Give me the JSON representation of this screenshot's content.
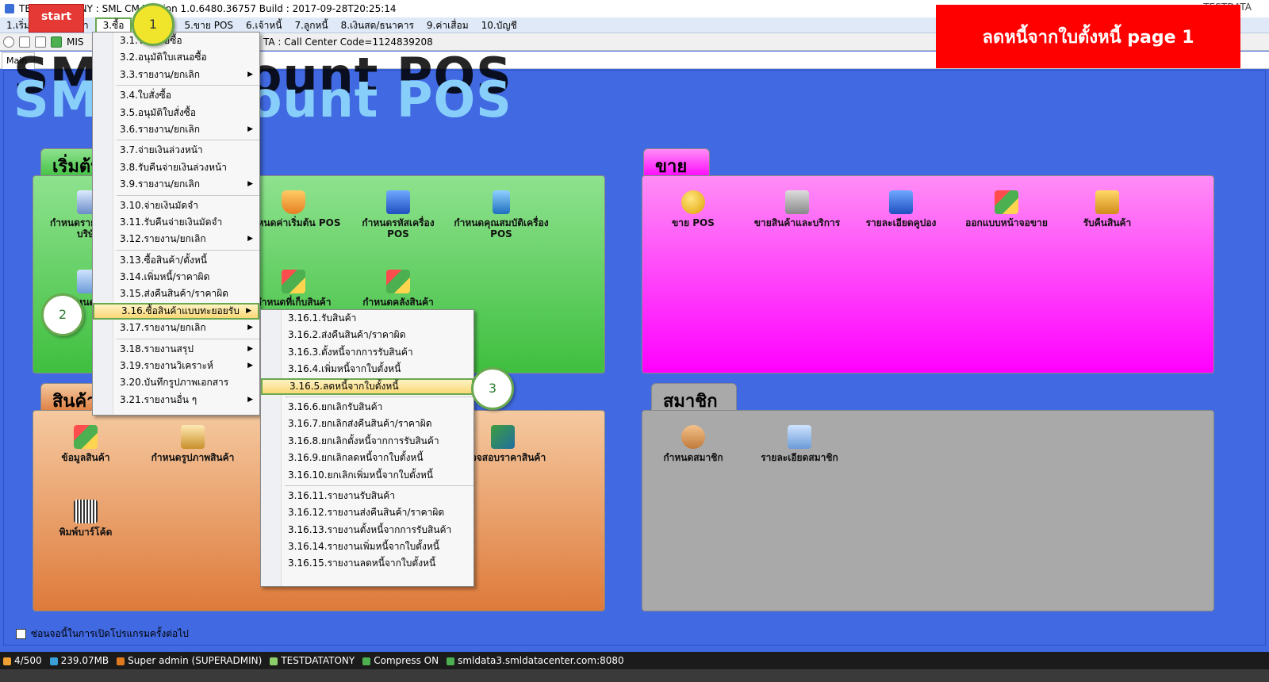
{
  "window": {
    "title": "TESTDATATONY : SML CM Version 1.0.6480.36757  Build : 2017-09-28T20:25:14",
    "top_right": "TESTDATA"
  },
  "start_label": "start",
  "banner": "ลดหนี้จากใบตั้งหนี้  page 1",
  "menubar": {
    "items": [
      "1.เริ่มต้น",
      "2.สินค้า",
      "3.ซื้อ",
      "5.ขาย POS",
      "6.เจ้าหนี้",
      "7.ลูกหนี้",
      "8.เงินสด/ธนาคาร",
      "9.ค่าเสื่อม",
      "10.บัญชี"
    ]
  },
  "toolbar": {
    "mis": "MIS",
    "call_center": "TA : Call Center Code=1124839208"
  },
  "tab_main": "Main",
  "big_title": "SML Account POS",
  "panels": {
    "start": {
      "label": "เริ่มต้น"
    },
    "product": {
      "label": "สินค้า"
    },
    "sale": {
      "label": "ขาย"
    },
    "member": {
      "label": "สมาชิก"
    }
  },
  "tiles": {
    "start": [
      "กำหนดรายละเอียดบริษัท",
      "กำหนดค่าเริ่มต้น POS",
      "กำหนดรหัสเครื่อง POS",
      "กำหนดคุณสมบัติเครื่อง POS",
      "กำหนดผู้ใช้",
      "กำหนดที่เก็บสินค้า",
      "กำหนดคลังสินค้า"
    ],
    "product": [
      "ข้อมูลสินค้า",
      "กำหนดรูปภาพสินค้า",
      "ตรวจสอบราคาสินค้า",
      "พิมพ์บาร์โค้ด"
    ],
    "sale": [
      "ขาย POS",
      "ขายสินค้าและบริการ",
      "รายละเอียดคูปอง",
      "ออกแบบหน้าจอขาย",
      "รับคืนสินค้า"
    ],
    "member": [
      "กำหนดสมาชิก",
      "รายละเอียดสมาชิก"
    ]
  },
  "checkbox_label": "ซ่อนจอนี้ในการเปิดโปรแกรมครั้งต่อไป",
  "menu_buy": {
    "items": [
      {
        "label": "3.1.ใบเสนอซื้อ",
        "sub": false
      },
      {
        "label": "3.2.อนุมัติใบเสนอซื้อ",
        "sub": false
      },
      {
        "label": "3.3.รายงาน/ยกเลิก",
        "sub": true
      },
      {
        "label": "3.4.ใบสั่งซื้อ",
        "sub": false
      },
      {
        "label": "3.5.อนุมัติใบสั่งซื้อ",
        "sub": false
      },
      {
        "label": "3.6.รายงาน/ยกเลิก",
        "sub": true
      },
      {
        "label": "3.7.จ่ายเงินล่วงหน้า",
        "sub": false
      },
      {
        "label": "3.8.รับคืนจ่ายเงินล่วงหน้า",
        "sub": false
      },
      {
        "label": "3.9.รายงาน/ยกเลิก",
        "sub": true
      },
      {
        "label": "3.10.จ่ายเงินมัดจำ",
        "sub": false
      },
      {
        "label": "3.11.รับคืนจ่ายเงินมัดจำ",
        "sub": false
      },
      {
        "label": "3.12.รายงาน/ยกเลิก",
        "sub": true
      },
      {
        "label": "3.13.ซื้อสินค้า/ตั้งหนี้",
        "sub": false
      },
      {
        "label": "3.14.เพิ่มหนี้/ราคาผิด",
        "sub": false
      },
      {
        "label": "3.15.ส่งคืนสินค้า/ราคาผิด",
        "sub": false
      },
      {
        "label": "3.16.ซื้อสินค้าแบบทะยอยรับ",
        "sub": true
      },
      {
        "label": "3.17.รายงาน/ยกเลิก",
        "sub": true
      },
      {
        "label": "3.18.รายงานสรุป",
        "sub": true
      },
      {
        "label": "3.19.รายงานวิเคราะห์",
        "sub": true
      },
      {
        "label": "3.20.บันทึกรูปภาพเอกสาร",
        "sub": false
      },
      {
        "label": "3.21.รายงานอื่น ๆ",
        "sub": true
      }
    ]
  },
  "menu_sub": {
    "items": [
      "3.16.1.รับสินค้า",
      "3.16.2.ส่งคืนสินค้า/ราคาผิด",
      "3.16.3.ตั้งหนี้จากการรับสินค้า",
      "3.16.4.เพิ่มหนี้จากใบตั้งหนี้",
      "3.16.5.ลดหนี้จากใบตั้งหนี้",
      "3.16.6.ยกเลิกรับสินค้า",
      "3.16.7.ยกเลิกส่งคืนสินค้า/ราคาผิด",
      "3.16.8.ยกเลิกตั้งหนี้จากการรับสินค้า",
      "3.16.9.ยกเลิกลดหนี้จากใบตั้งหนี้",
      "3.16.10.ยกเลิกเพิ่มหนี้จากใบตั้งหนี้",
      "3.16.11.รายงานรับสินค้า",
      "3.16.12.รายงานส่งคืนสินค้า/ราคาผิด",
      "3.16.13.รายงานตั้งหนี้จากการรับสินค้า",
      "3.16.14.รายงานเพิ่มหนี้จากใบตั้งหนี้",
      "3.16.15.รายงานลดหนี้จากใบตั้งหนี้"
    ]
  },
  "callouts": [
    "1",
    "2",
    "3"
  ],
  "status": {
    "sessions": "4/500",
    "memory": "239.07MB",
    "user": "Super admin (SUPERADMIN)",
    "db": "TESTDATATONY",
    "compress": "Compress ON",
    "server": "smldata3.smldatacenter.com:8080"
  },
  "colors": {
    "desktop": "#4169e1",
    "banner": "#ff0000",
    "highlight_border": "#6aa84f",
    "callout_yellow": "#f1e52b"
  }
}
